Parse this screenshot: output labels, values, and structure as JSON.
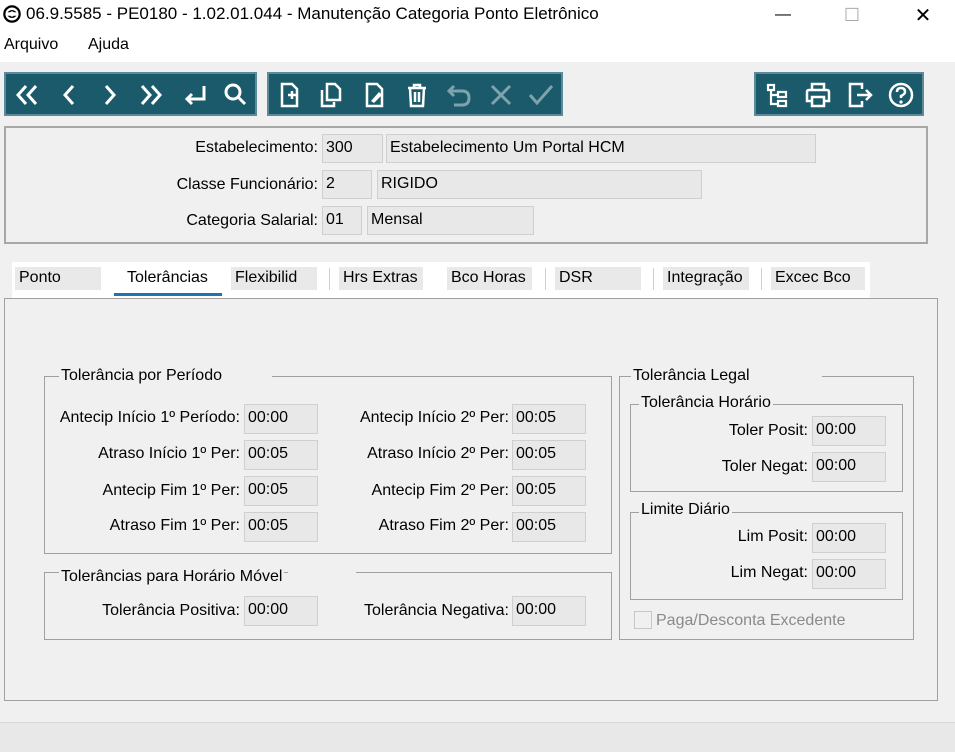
{
  "window": {
    "title": "06.9.5585 - PE0180 - 1.02.01.044 - Manutenção Categoria Ponto Eletrônico",
    "minimize_glyph": "—",
    "maximize_glyph": "☐",
    "close_glyph": "✕"
  },
  "menu": [
    "Arquivo",
    "Ajuda"
  ],
  "toolbar": {
    "nav_icons": [
      "first-icon",
      "previous-icon",
      "next-icon",
      "last-icon",
      "goto-icon",
      "search-icon"
    ],
    "edit_icons": [
      "new-icon",
      "copy-icon",
      "edit-icon",
      "delete-icon",
      "undo-icon",
      "cancel-icon",
      "confirm-icon"
    ],
    "util_icons": [
      "tree-icon",
      "print-icon",
      "exit-icon",
      "help-icon"
    ],
    "color": "#1a5a6b"
  },
  "header": {
    "estabelecimento_label": "Estabelecimento:",
    "estabelecimento_code": "300",
    "estabelecimento_name": "Estabelecimento Um Portal HCM",
    "classe_label": "Classe Funcionário:",
    "classe_code": "2",
    "classe_name": "RIGIDO",
    "categoria_label": "Categoria Salarial:",
    "categoria_code": "01",
    "categoria_name": "Mensal"
  },
  "tabs": [
    "Ponto",
    "Tolerâncias",
    "Flexibilid",
    "Hrs Extras",
    "Bco Horas",
    "DSR",
    "Integração",
    "Excec Bco"
  ],
  "active_tab": "Tolerâncias",
  "tolerancia_periodo": {
    "title": "Tolerância por Período",
    "rows": [
      {
        "label1": "Antecip Início 1º Período:",
        "value1": "00:00",
        "label2": "Antecip Início 2º Per:",
        "value2": "00:05"
      },
      {
        "label1": "Atraso Início 1º Per:",
        "value1": "00:05",
        "label2": "Atraso Início 2º Per:",
        "value2": "00:05"
      },
      {
        "label1": "Antecip Fim 1º Per:",
        "value1": "00:05",
        "label2": "Antecip Fim 2º Per:",
        "value2": "00:05"
      },
      {
        "label1": "Atraso Fim 1º Per:",
        "value1": "00:05",
        "label2": "Atraso Fim 2º Per:",
        "value2": "00:05"
      }
    ]
  },
  "horario_movel": {
    "title": "Tolerâncias para Horário Móvel",
    "positiva_label": "Tolerância Positiva:",
    "positiva_value": "00:00",
    "negativa_label": "Tolerância Negativa:",
    "negativa_value": "00:00"
  },
  "tolerancia_legal": {
    "title": "Tolerância Legal",
    "horario_title": "Tolerância Horário",
    "toler_posit_label": "Toler Posit:",
    "toler_posit_value": "00:00",
    "toler_negat_label": "Toler Negat:",
    "toler_negat_value": "00:00",
    "limite_title": "Limite Diário",
    "lim_posit_label": "Lim Posit:",
    "lim_posit_value": "00:00",
    "lim_negat_label": "Lim Negat:",
    "lim_negat_value": "00:00",
    "paga_label": "Paga/Desconta Excedente"
  }
}
